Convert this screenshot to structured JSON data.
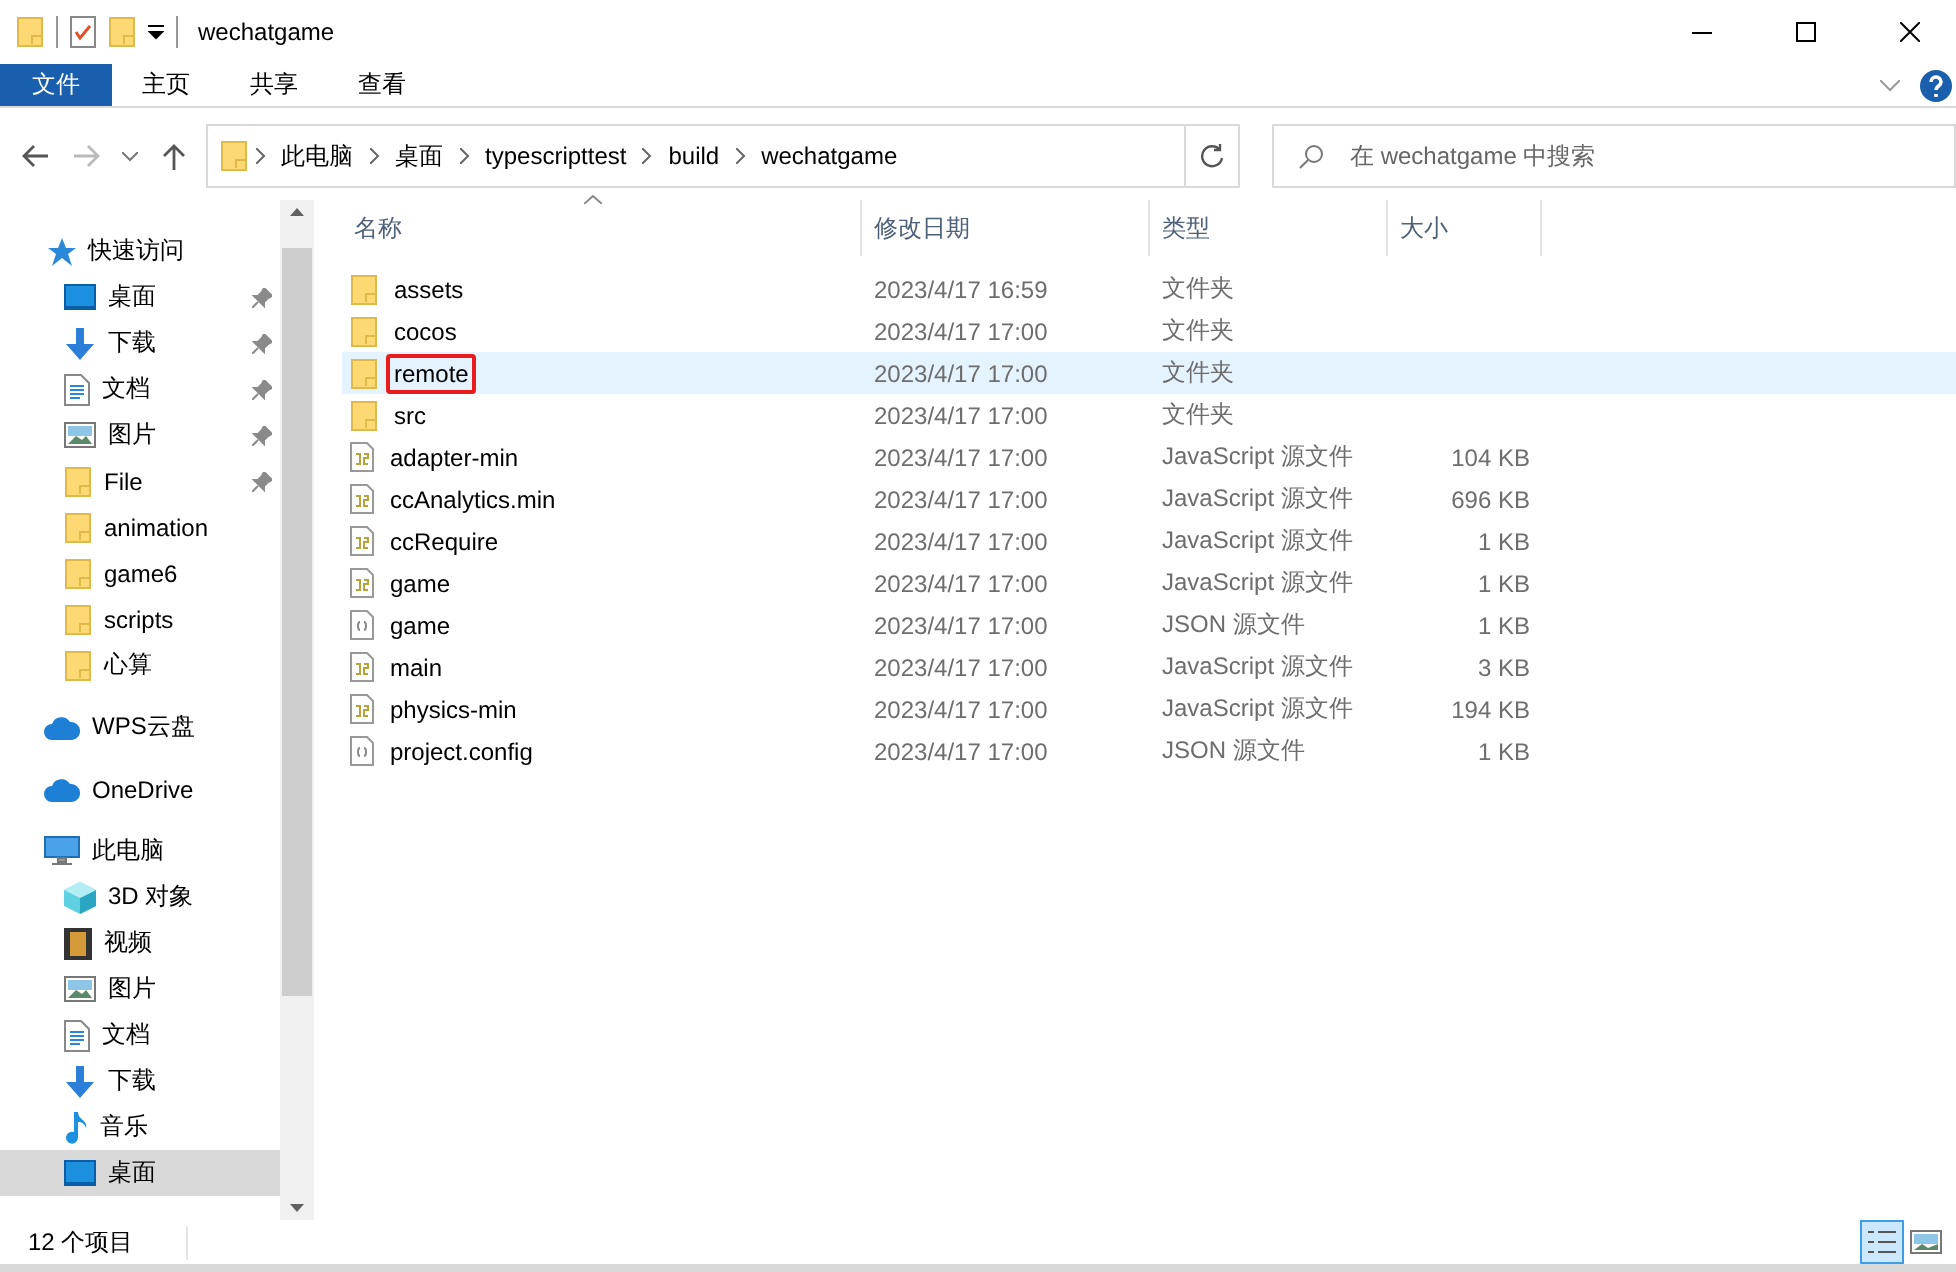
{
  "window": {
    "title": "wechatgame"
  },
  "ribbon_tabs": [
    {
      "label": "文件",
      "selected": true
    },
    {
      "label": "主页",
      "selected": false
    },
    {
      "label": "共享",
      "selected": false
    },
    {
      "label": "查看",
      "selected": false
    }
  ],
  "breadcrumb": [
    "此电脑",
    "桌面",
    "typescripttest",
    "build",
    "wechatgame"
  ],
  "search": {
    "placeholder": "在 wechatgame 中搜索"
  },
  "nav": [
    {
      "label": "快速访问",
      "kind": "star",
      "selected": false,
      "children": [
        {
          "label": "桌面",
          "kind": "desktop",
          "pinned": true,
          "selected": false
        },
        {
          "label": "下载",
          "kind": "download",
          "pinned": true,
          "selected": false
        },
        {
          "label": "文档",
          "kind": "document",
          "pinned": true,
          "selected": false
        },
        {
          "label": "图片",
          "kind": "picture",
          "pinned": true,
          "selected": false
        },
        {
          "label": "File",
          "kind": "folder",
          "pinned": true,
          "selected": false
        },
        {
          "label": "animation",
          "kind": "folder",
          "pinned": false,
          "selected": false
        },
        {
          "label": "game6",
          "kind": "folder",
          "pinned": false,
          "selected": false
        },
        {
          "label": "scripts",
          "kind": "folder",
          "pinned": false,
          "selected": false
        },
        {
          "label": "心算",
          "kind": "folder",
          "pinned": false,
          "selected": false
        }
      ]
    },
    {
      "label": "WPS云盘",
      "kind": "cloud",
      "selected": false
    },
    {
      "label": "OneDrive",
      "kind": "cloud",
      "selected": false
    },
    {
      "label": "此电脑",
      "kind": "computer",
      "selected": false,
      "children": [
        {
          "label": "3D 对象",
          "kind": "cube",
          "selected": false
        },
        {
          "label": "视频",
          "kind": "video",
          "selected": false
        },
        {
          "label": "图片",
          "kind": "picture",
          "selected": false
        },
        {
          "label": "文档",
          "kind": "document",
          "selected": false
        },
        {
          "label": "下载",
          "kind": "download",
          "selected": false
        },
        {
          "label": "音乐",
          "kind": "music",
          "selected": false
        },
        {
          "label": "桌面",
          "kind": "desktop",
          "selected": true
        }
      ]
    }
  ],
  "columns": [
    "名称",
    "修改日期",
    "类型",
    "大小"
  ],
  "files": [
    {
      "name": "assets",
      "kind": "folder",
      "date": "2023/4/17 16:59",
      "type": "文件夹",
      "selected": false
    },
    {
      "name": "cocos",
      "kind": "folder",
      "date": "2023/4/17 17:00",
      "type": "文件夹",
      "selected": false
    },
    {
      "name": "remote",
      "kind": "folder",
      "date": "2023/4/17 17:00",
      "type": "文件夹",
      "selected": true,
      "outlined": true
    },
    {
      "name": "src",
      "kind": "folder",
      "date": "2023/4/17 17:00",
      "type": "文件夹",
      "selected": false
    },
    {
      "name": "adapter-min",
      "kind": "js",
      "date": "2023/4/17 17:00",
      "type": "JavaScript 源文件",
      "size": "104 KB",
      "selected": false
    },
    {
      "name": "ccAnalytics.min",
      "kind": "js",
      "date": "2023/4/17 17:00",
      "type": "JavaScript 源文件",
      "size": "696 KB",
      "selected": false
    },
    {
      "name": "ccRequire",
      "kind": "js",
      "date": "2023/4/17 17:00",
      "type": "JavaScript 源文件",
      "size": "1 KB",
      "selected": false
    },
    {
      "name": "game",
      "kind": "js",
      "date": "2023/4/17 17:00",
      "type": "JavaScript 源文件",
      "size": "1 KB",
      "selected": false
    },
    {
      "name": "game",
      "kind": "json",
      "date": "2023/4/17 17:00",
      "type": "JSON 源文件",
      "size": "1 KB",
      "selected": false
    },
    {
      "name": "main",
      "kind": "js",
      "date": "2023/4/17 17:00",
      "type": "JavaScript 源文件",
      "size": "3 KB",
      "selected": false
    },
    {
      "name": "physics-min",
      "kind": "js",
      "date": "2023/4/17 17:00",
      "type": "JavaScript 源文件",
      "size": "194 KB",
      "selected": false
    },
    {
      "name": "project.config",
      "kind": "json",
      "date": "2023/4/17 17:00",
      "type": "JSON 源文件",
      "size": "1 KB",
      "selected": false
    }
  ],
  "status_bar": {
    "count": "12 个项目",
    "view_buttons": [
      {
        "kind": "details",
        "selected": true
      },
      {
        "kind": "thumbnails",
        "selected": false
      }
    ]
  }
}
